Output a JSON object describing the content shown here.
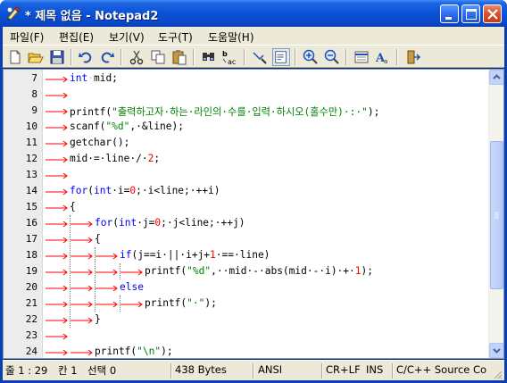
{
  "window": {
    "title": "* 제목 없음 - Notepad2",
    "title_icon": "notepad2-app-icon",
    "controls": [
      "minimize",
      "maximize",
      "close"
    ]
  },
  "menu": [
    "파일(F)",
    "편집(E)",
    "보기(V)",
    "도구(T)",
    "도움말(H)"
  ],
  "toolbar": {
    "icons": [
      "new-file-icon",
      "open-folder-icon",
      "save-icon",
      "undo-icon",
      "redo-icon",
      "cut-icon",
      "copy-icon",
      "paste-icon",
      "find-icon",
      "replace-icon",
      "word-wrap-icon",
      "view-whitespace-icon",
      "zoom-in-icon",
      "zoom-out-icon",
      "scheme-icon",
      "font-icon",
      "exit-icon"
    ],
    "pressed": "view-whitespace-icon"
  },
  "editor": {
    "lines": [
      {
        "num": "7",
        "indent": 1,
        "tokens": [
          [
            "kw",
            "int"
          ],
          [
            "dot",
            "·"
          ],
          [
            "",
            "mid;"
          ]
        ]
      },
      {
        "num": "8",
        "indent": 1,
        "tokens": []
      },
      {
        "num": "9",
        "indent": 1,
        "tokens": [
          [
            "",
            "printf("
          ],
          [
            "str",
            "\"출력하고자·하는·라인의·수를·입력·하시오(홀수만)·:·\""
          ],
          [
            "",
            "); "
          ]
        ]
      },
      {
        "num": "10",
        "indent": 1,
        "tokens": [
          [
            "",
            "scanf("
          ],
          [
            "str",
            "\"%d\""
          ],
          [
            "",
            ",·&line);"
          ]
        ]
      },
      {
        "num": "11",
        "indent": 1,
        "tokens": [
          [
            "",
            "getchar();"
          ]
        ]
      },
      {
        "num": "12",
        "indent": 1,
        "tokens": [
          [
            "",
            "mid·=·line·/·"
          ],
          [
            "num",
            "2"
          ],
          [
            "",
            ";"
          ]
        ]
      },
      {
        "num": "13",
        "indent": 1,
        "tokens": []
      },
      {
        "num": "14",
        "indent": 1,
        "tokens": [
          [
            "kw",
            "for"
          ],
          [
            "",
            "("
          ],
          [
            "kw",
            "int"
          ],
          [
            "",
            "·i="
          ],
          [
            "num",
            "0"
          ],
          [
            "",
            ";·i<line;·++i)"
          ]
        ]
      },
      {
        "num": "15",
        "indent": 1,
        "tokens": [
          [
            "",
            "{"
          ]
        ]
      },
      {
        "num": "16",
        "indent": 2,
        "tokens": [
          [
            "kw",
            "for"
          ],
          [
            "",
            "("
          ],
          [
            "kw",
            "int"
          ],
          [
            "",
            "·j="
          ],
          [
            "num",
            "0"
          ],
          [
            "",
            ";·j<line;·++j)"
          ]
        ]
      },
      {
        "num": "17",
        "indent": 2,
        "tokens": [
          [
            "",
            "{"
          ]
        ]
      },
      {
        "num": "18",
        "indent": 3,
        "tokens": [
          [
            "kw",
            "if"
          ],
          [
            "",
            "(j==i·||·i+j+"
          ],
          [
            "num",
            "1"
          ],
          [
            "",
            "·==·line)"
          ]
        ]
      },
      {
        "num": "19",
        "indent": 4,
        "tokens": [
          [
            "",
            "printf("
          ],
          [
            "str",
            "\"%d\""
          ],
          [
            "",
            ",··mid·-·abs(mid·-·i)·+·"
          ],
          [
            "num",
            "1"
          ],
          [
            "",
            ");"
          ]
        ]
      },
      {
        "num": "20",
        "indent": 3,
        "tokens": [
          [
            "kw",
            "else"
          ]
        ]
      },
      {
        "num": "21",
        "indent": 4,
        "tokens": [
          [
            "",
            "printf("
          ],
          [
            "str",
            "\"·\""
          ],
          [
            "",
            ");"
          ]
        ]
      },
      {
        "num": "22",
        "indent": 2,
        "tokens": [
          [
            "",
            "}"
          ]
        ]
      },
      {
        "num": "23",
        "indent": 1,
        "tokens": []
      },
      {
        "num": "24",
        "indent": 2,
        "tokens": [
          [
            "",
            "printf("
          ],
          [
            "str",
            "\"\\n\""
          ],
          [
            "",
            ");"
          ]
        ]
      }
    ]
  },
  "statusbar": {
    "position": "줄 1 : 29",
    "column": "칸 1",
    "selection": "선택 0",
    "size": "438 Bytes",
    "encoding": "ANSI",
    "eol": "CR+LF",
    "ovr": "INS",
    "scheme": "C/C++ Source Co"
  },
  "colors": {
    "keyword": "#0000ff",
    "string": "#008000",
    "number": "#ff0000",
    "tab_arrow": "#ff0000",
    "title_bar": "#0a52d8",
    "chrome": "#ece9d8"
  }
}
